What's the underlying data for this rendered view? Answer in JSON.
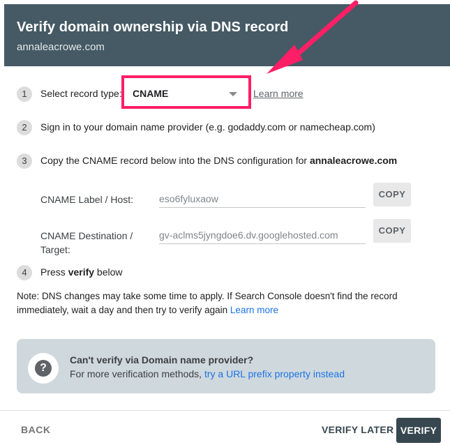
{
  "header": {
    "title": "Verify domain ownership via DNS record",
    "subtitle": "annaleacrowe.com"
  },
  "steps": [
    {
      "num": "1",
      "label": "Select record type:"
    },
    {
      "num": "2",
      "label": "Sign in to your domain name provider (e.g. godaddy.com or namecheap.com)"
    },
    {
      "num": "3",
      "label_prefix": "Copy the CNAME record below into the DNS configuration for ",
      "label_domain": "annaleacrowe.com"
    },
    {
      "num": "4",
      "label_prefix": "Press ",
      "label_bold": "verify",
      "label_suffix": " below"
    }
  ],
  "record_type": {
    "selected": "CNAME",
    "learn_more": "Learn more"
  },
  "fields": [
    {
      "label": "CNAME Label / Host:",
      "value": "eso6fyluxaow",
      "copy": "COPY"
    },
    {
      "label": "CNAME Destination / Target:",
      "value": "gv-aclms5jyngdoe6.dv.googlehosted.com",
      "copy": "COPY"
    }
  ],
  "note": {
    "text": "Note: DNS changes may take some time to apply. If Search Console doesn't find the record immediately, wait a day and then try to verify again",
    "link": "Learn more"
  },
  "info": {
    "title": "Can't verify via Domain name provider?",
    "text": "For more verification methods, ",
    "link": "try a URL prefix property instead",
    "icon": "help-icon"
  },
  "footer": {
    "back": "BACK",
    "verify_later": "VERIFY LATER",
    "verify": "VERIFY"
  },
  "colors": {
    "header_bg": "#455a64",
    "highlight": "#ff1f66",
    "link": "#1a73e8",
    "info_bg": "#cfd8dc"
  }
}
